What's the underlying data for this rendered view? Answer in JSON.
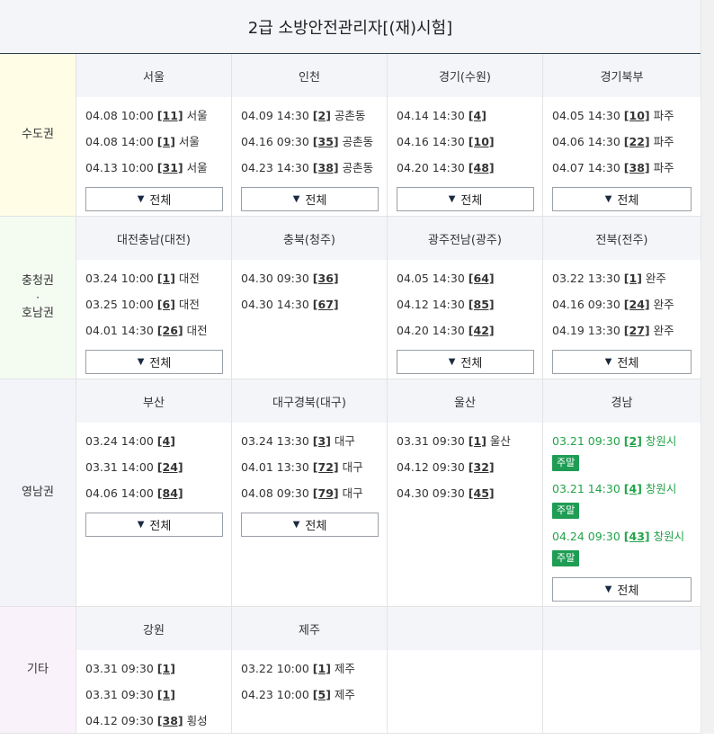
{
  "page_title": "2급 소방안전관리자[(재)시험]",
  "all_button_label": "전체",
  "all_button_icon": "▼",
  "weekend_badge": "주말",
  "colors": {
    "weekend": "#23a34a",
    "badge": "#1f9d55"
  },
  "regions": [
    {
      "label": [
        "수도권"
      ],
      "bg": "#fffde6",
      "cells": [
        {
          "title": "서울",
          "entries": [
            {
              "datetime": "04.08 10:00",
              "code": "[11]",
              "place": "서울"
            },
            {
              "datetime": "04.08 14:00",
              "code": "[1]",
              "place": "서울"
            },
            {
              "datetime": "04.13 10:00",
              "code": "[31]",
              "place": "서울"
            }
          ],
          "show_all": true
        },
        {
          "title": "인천",
          "entries": [
            {
              "datetime": "04.09 14:30",
              "code": "[2]",
              "place": "공촌동"
            },
            {
              "datetime": "04.16 09:30",
              "code": "[35]",
              "place": "공촌동"
            },
            {
              "datetime": "04.23 14:30",
              "code": "[38]",
              "place": "공촌동"
            }
          ],
          "show_all": true
        },
        {
          "title": "경기(수원)",
          "entries": [
            {
              "datetime": "04.14 14:30",
              "code": "[4]",
              "place": ""
            },
            {
              "datetime": "04.16 14:30",
              "code": "[10]",
              "place": ""
            },
            {
              "datetime": "04.20 14:30",
              "code": "[48]",
              "place": ""
            }
          ],
          "show_all": true
        },
        {
          "title": "경기북부",
          "entries": [
            {
              "datetime": "04.05 14:30",
              "code": "[10]",
              "place": "파주"
            },
            {
              "datetime": "04.06 14:30",
              "code": "[22]",
              "place": "파주"
            },
            {
              "datetime": "04.07 14:30",
              "code": "[38]",
              "place": "파주"
            }
          ],
          "show_all": true
        }
      ]
    },
    {
      "label": [
        "충청권",
        "·",
        "호남권"
      ],
      "bg": "#f4fbf1",
      "cells": [
        {
          "title": "대전충남(대전)",
          "entries": [
            {
              "datetime": "03.24 10:00",
              "code": "[1]",
              "place": "대전"
            },
            {
              "datetime": "03.25 10:00",
              "code": "[6]",
              "place": "대전"
            },
            {
              "datetime": "04.01 14:30",
              "code": "[26]",
              "place": "대전"
            }
          ],
          "show_all": true
        },
        {
          "title": "충북(청주)",
          "entries": [
            {
              "datetime": "04.30 09:30",
              "code": "[36]",
              "place": ""
            },
            {
              "datetime": "04.30 14:30",
              "code": "[67]",
              "place": ""
            }
          ],
          "show_all": false
        },
        {
          "title": "광주전남(광주)",
          "entries": [
            {
              "datetime": "04.05 14:30",
              "code": "[64]",
              "place": ""
            },
            {
              "datetime": "04.12 14:30",
              "code": "[85]",
              "place": ""
            },
            {
              "datetime": "04.20 14:30",
              "code": "[42]",
              "place": ""
            }
          ],
          "show_all": true
        },
        {
          "title": "전북(전주)",
          "entries": [
            {
              "datetime": "03.22 13:30",
              "code": "[1]",
              "place": "완주"
            },
            {
              "datetime": "04.16 09:30",
              "code": "[24]",
              "place": "완주"
            },
            {
              "datetime": "04.19 13:30",
              "code": "[27]",
              "place": "완주"
            }
          ],
          "show_all": true
        }
      ]
    },
    {
      "label": [
        "영남권"
      ],
      "bg": "#f2f4fa",
      "cells": [
        {
          "title": "부산",
          "entries": [
            {
              "datetime": "03.24 14:00",
              "code": "[4]",
              "place": ""
            },
            {
              "datetime": "03.31 14:00",
              "code": "[24]",
              "place": ""
            },
            {
              "datetime": "04.06 14:00",
              "code": "[84]",
              "place": ""
            }
          ],
          "show_all": true
        },
        {
          "title": "대구경북(대구)",
          "entries": [
            {
              "datetime": "03.24 13:30",
              "code": "[3]",
              "place": "대구"
            },
            {
              "datetime": "04.01 13:30",
              "code": "[72]",
              "place": "대구"
            },
            {
              "datetime": "04.08 09:30",
              "code": "[79]",
              "place": "대구"
            }
          ],
          "show_all": true
        },
        {
          "title": "울산",
          "entries": [
            {
              "datetime": "03.31 09:30",
              "code": "[1]",
              "place": "울산"
            },
            {
              "datetime": "04.12 09:30",
              "code": "[32]",
              "place": ""
            },
            {
              "datetime": "04.30 09:30",
              "code": "[45]",
              "place": ""
            }
          ],
          "show_all": false
        },
        {
          "title": "경남",
          "entries": [
            {
              "datetime": "03.21 09:30",
              "code": "[2]",
              "place": "창원시",
              "weekend": true
            },
            {
              "datetime": "03.21 14:30",
              "code": "[4]",
              "place": "창원시",
              "weekend": true
            },
            {
              "datetime": "04.24 09:30",
              "code": "[43]",
              "place": "창원시",
              "weekend": true
            }
          ],
          "show_all": true
        }
      ]
    },
    {
      "label": [
        "기타"
      ],
      "bg": "#faf2fa",
      "cells": [
        {
          "title": "강원",
          "entries": [
            {
              "datetime": "03.31 09:30",
              "code": "[1]",
              "place": ""
            },
            {
              "datetime": "03.31 09:30",
              "code": "[1]",
              "place": ""
            },
            {
              "datetime": "04.12 09:30",
              "code": "[38]",
              "place": "횡성"
            }
          ],
          "show_all": false
        },
        {
          "title": "제주",
          "entries": [
            {
              "datetime": "03.22 10:00",
              "code": "[1]",
              "place": "제주"
            },
            {
              "datetime": "04.23 10:00",
              "code": "[5]",
              "place": "제주"
            }
          ],
          "show_all": false
        },
        {
          "title": "",
          "entries": [],
          "show_all": false
        },
        {
          "title": "",
          "entries": [],
          "show_all": false
        }
      ]
    }
  ]
}
